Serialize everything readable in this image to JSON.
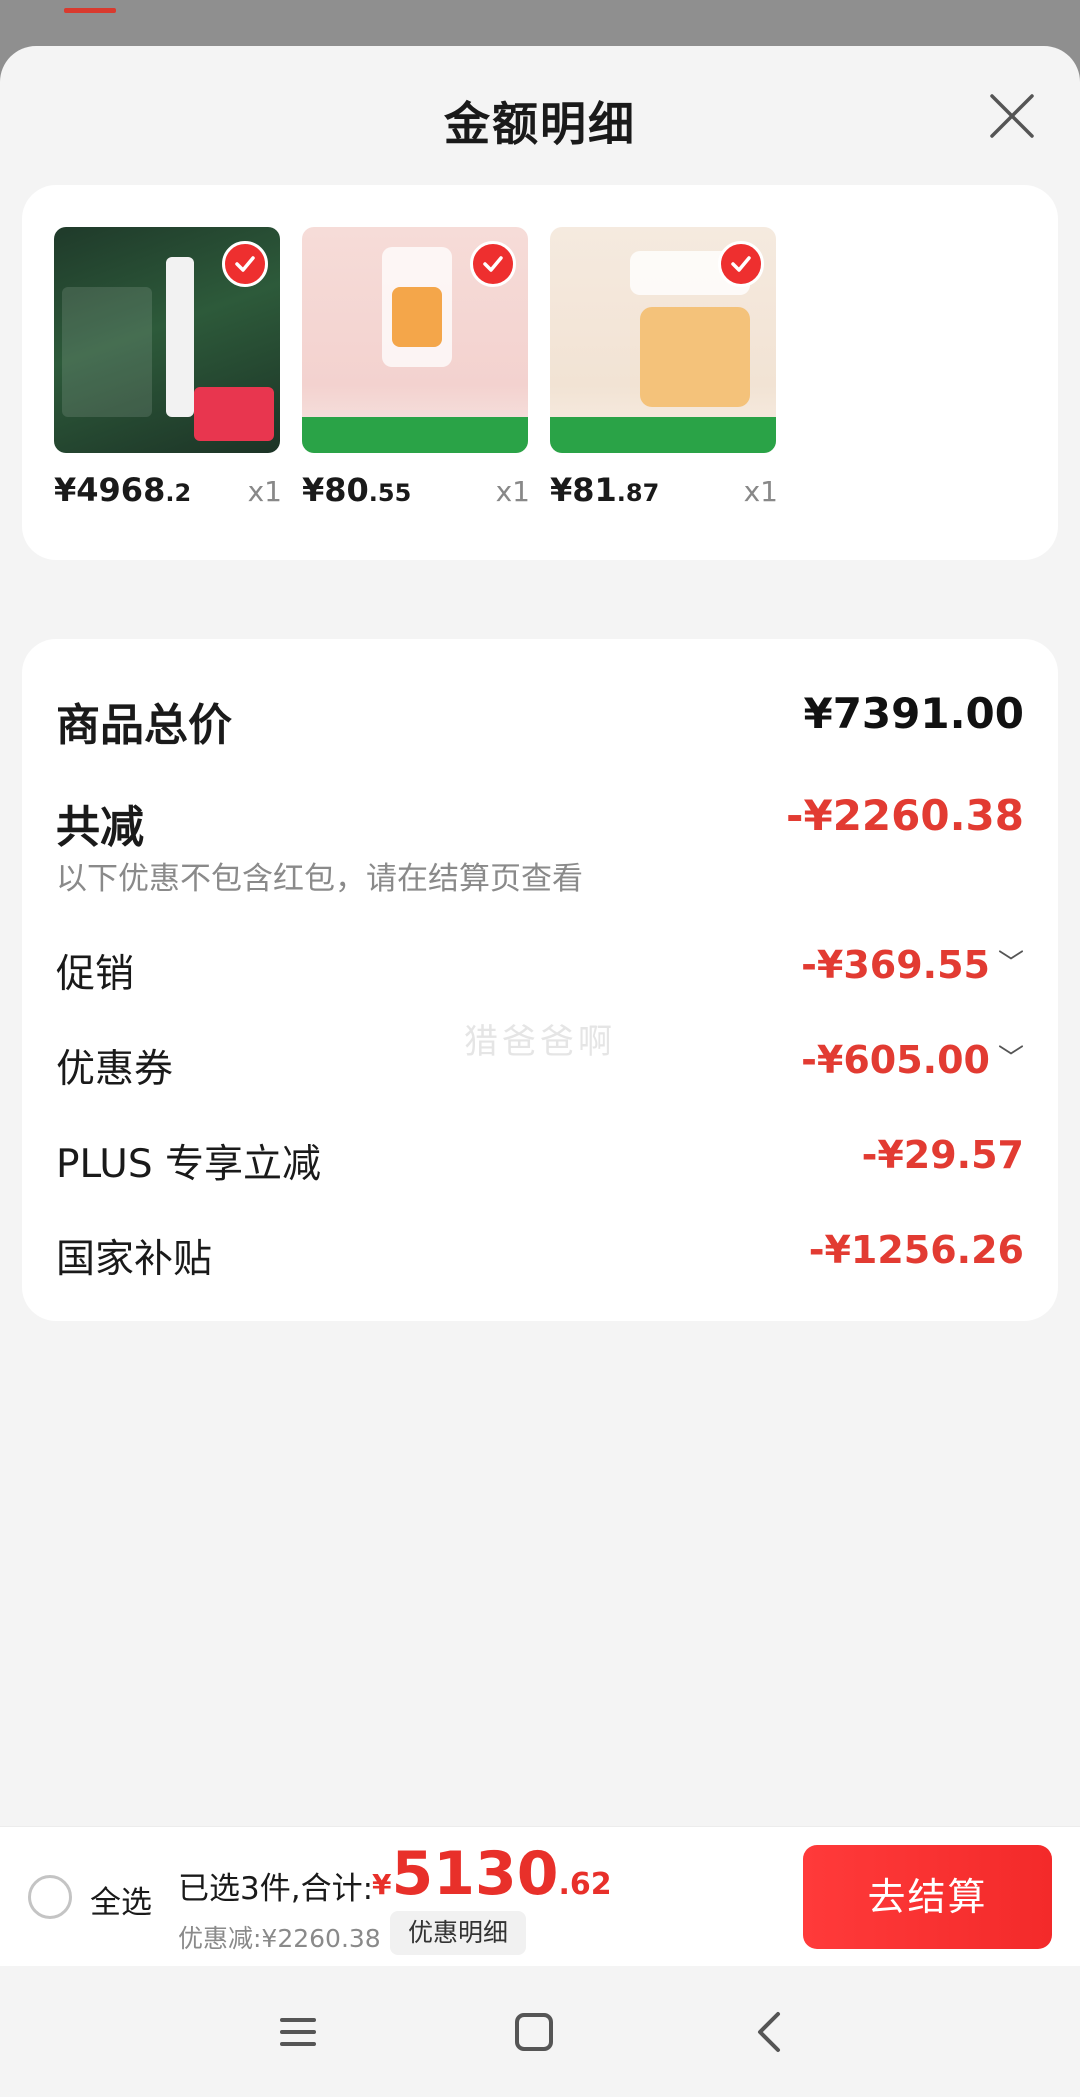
{
  "sheet": {
    "title": "金额明细"
  },
  "products": [
    {
      "price_int": "¥4968",
      "price_dec": ".2",
      "qty": "x1"
    },
    {
      "price_int": "¥80",
      "price_dec": ".55",
      "qty": "x1"
    },
    {
      "price_int": "¥81",
      "price_dec": ".87",
      "qty": "x1"
    }
  ],
  "detail": {
    "total_label": "商品总价",
    "total_value": "¥7391.00",
    "reduce_label": "共减",
    "reduce_value": "-¥2260.38",
    "note": "以下优惠不包含红包，请在结算页查看",
    "rows": [
      {
        "label": "促销",
        "value": "-¥369.55"
      },
      {
        "label": "优惠券",
        "value": "-¥605.00"
      },
      {
        "label": "PLUS 专享立减",
        "value": "-¥29.57"
      },
      {
        "label": "国家补贴",
        "value": "-¥1256.26"
      }
    ],
    "watermark": "猎爸爸啊"
  },
  "bottom": {
    "select_all_label": "全选",
    "summary_text": "已选3件,合计:",
    "total_symbol": "¥",
    "total_int": "5130",
    "total_dec": ".62",
    "discount_text": "优惠减:¥2260.38",
    "detail_link": "优惠明细",
    "checkout_label": "去结算"
  },
  "colors": {
    "accent_red": "#e8302a",
    "checkout_red": "#f32a2a",
    "sheet_bg": "#f4f4f4"
  },
  "icons": {
    "close": "close-icon",
    "check": "check-icon",
    "expand": "chevron-down-icon",
    "nav_menu": "menu-icon",
    "nav_home": "home-icon",
    "nav_back": "back-icon"
  }
}
